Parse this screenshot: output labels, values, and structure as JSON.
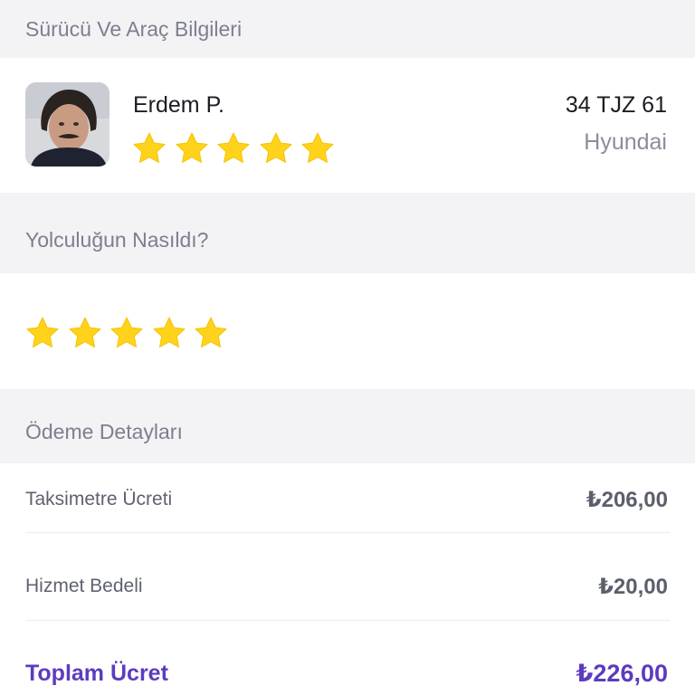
{
  "driver_section": {
    "title": "Sürücü Ve Araç Bilgileri",
    "driver_name": "Erdem P.",
    "driver_rating": 5,
    "plate": "34 TJZ 61",
    "brand": "Hyundai"
  },
  "ride_section": {
    "title": "Yolculuğun Nasıldı?",
    "rating": 5
  },
  "payment_section": {
    "title": "Ödeme Detayları",
    "rows": [
      {
        "label": "Taksimetre Ücreti",
        "value": "₺206,00"
      },
      {
        "label": "Hizmet Bedeli",
        "value": "₺20,00"
      }
    ],
    "total_label": "Toplam Ücret",
    "total_value": "₺226,00"
  },
  "colors": {
    "accent": "#5d3bbf",
    "star": "#ffd21c",
    "background": "#f3f3f5"
  }
}
